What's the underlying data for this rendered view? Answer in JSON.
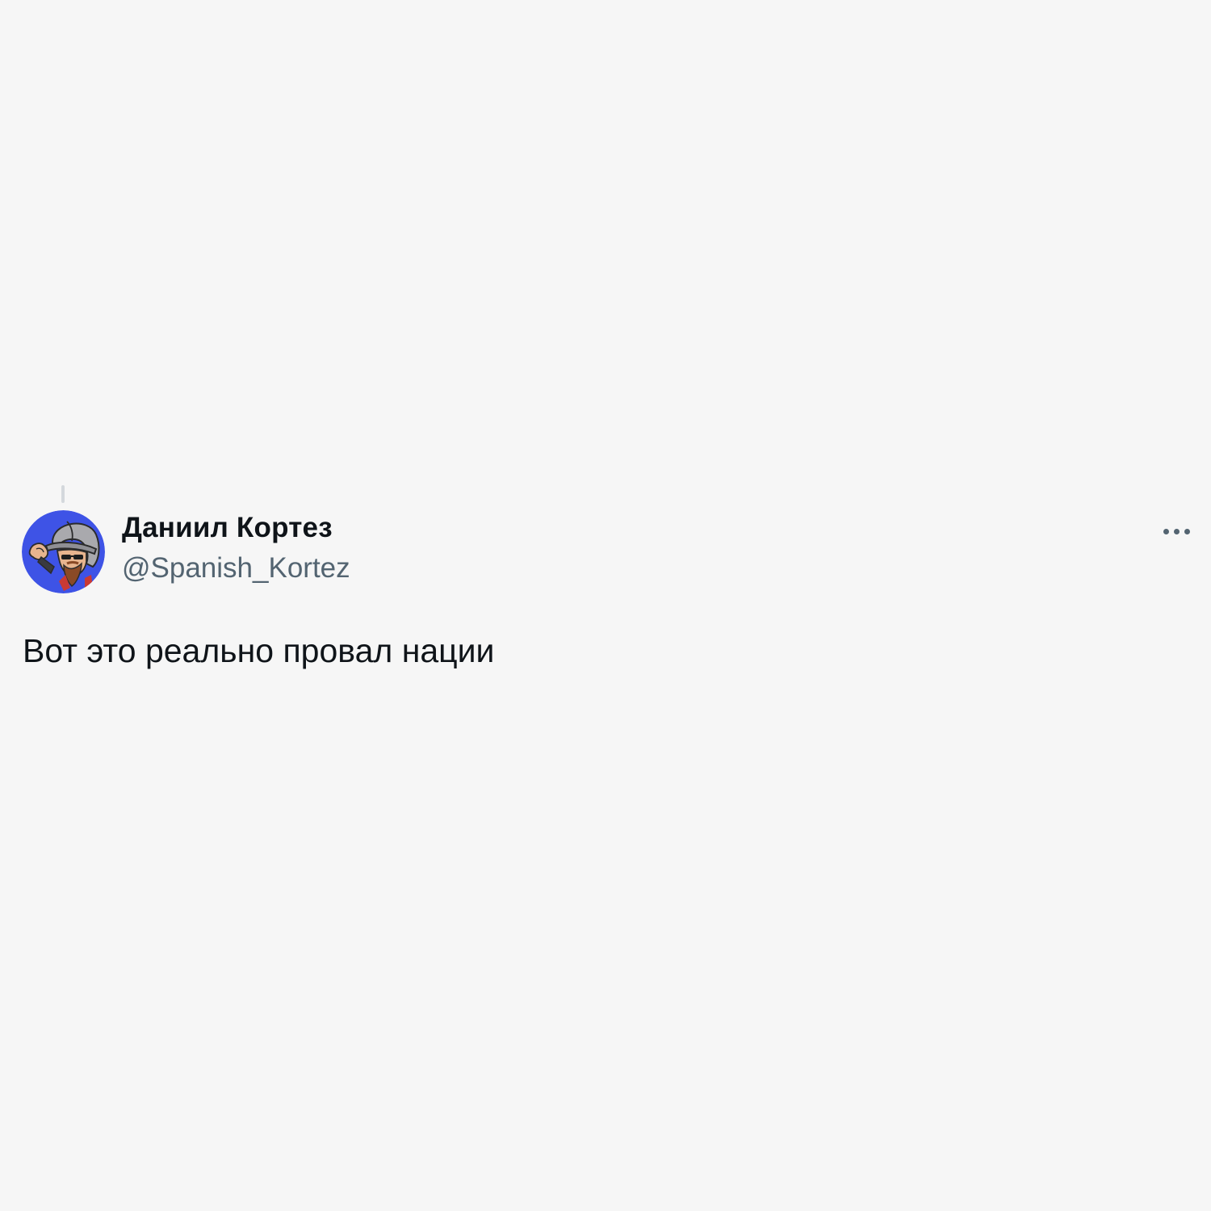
{
  "tweet": {
    "author": {
      "display_name": "Даниил Кортез",
      "handle": "@Spanish_Kortez",
      "avatar_icon": "cartoon-conquistador-avatar",
      "avatar_bg_color": "#3e53e6"
    },
    "more_icon": "more-horizontal-icon",
    "text": "Вот это реально провал нации"
  },
  "colors": {
    "background": "#f6f6f6",
    "primary_text": "#0f1419",
    "secondary_text": "#536471"
  }
}
